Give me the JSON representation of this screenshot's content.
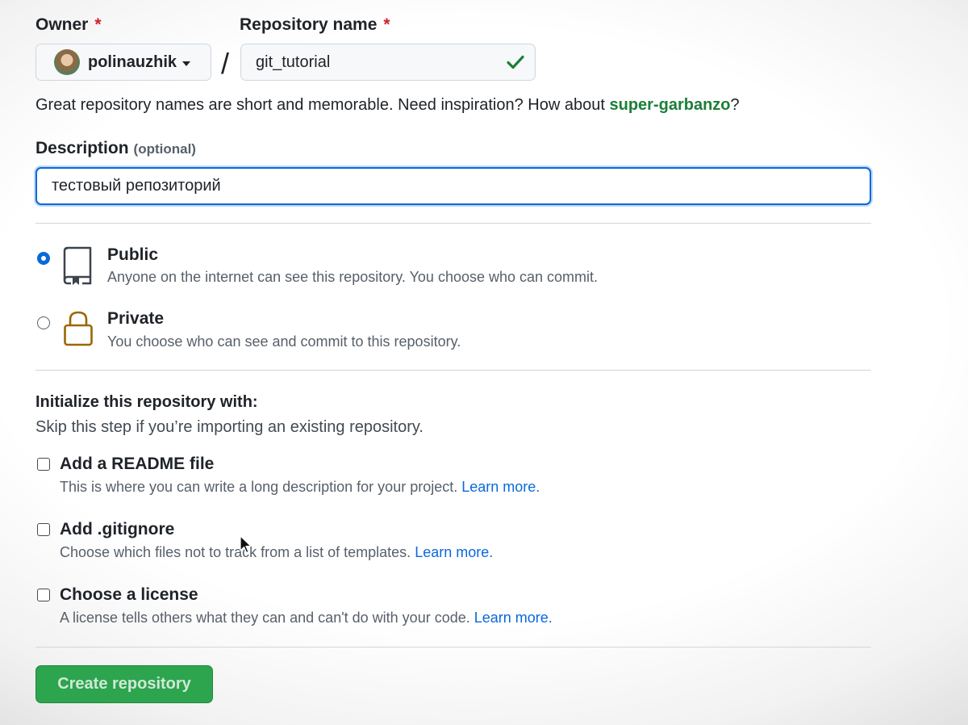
{
  "owner": {
    "label": "Owner",
    "required_mark": "*",
    "username": "polinauzhik"
  },
  "separator": "/",
  "repo": {
    "label": "Repository name",
    "required_mark": "*",
    "value": "git_tutorial"
  },
  "name_hint": {
    "prefix": "Great repository names are short and memorable. Need inspiration? How about ",
    "suggestion": "super-garbanzo",
    "suffix": "?"
  },
  "description": {
    "label": "Description",
    "optional": "(optional)",
    "value": "тестовый репозиторий"
  },
  "visibility": {
    "selected": "public",
    "public": {
      "title": "Public",
      "desc": "Anyone on the internet can see this repository. You choose who can commit."
    },
    "private": {
      "title": "Private",
      "desc": "You choose who can see and commit to this repository."
    }
  },
  "init": {
    "title": "Initialize this repository with:",
    "subtitle": "Skip this step if you’re importing an existing repository.",
    "options": [
      {
        "label": "Add a README file",
        "desc": "This is where you can write a long description for your project.",
        "link": "Learn more."
      },
      {
        "label": "Add .gitignore",
        "desc": "Choose which files not to track from a list of templates.",
        "link": "Learn more."
      },
      {
        "label": "Choose a license",
        "desc": "A license tells others what they can and can't do with your code.",
        "link": "Learn more."
      }
    ]
  },
  "create_button": "Create repository",
  "colors": {
    "accent": "#0969da",
    "success": "#2da44e",
    "required": "#cf222e",
    "private_icon": "#9a6700"
  },
  "icons": [
    "check-icon",
    "repo-icon",
    "lock-icon",
    "chevron-down-icon",
    "cursor-icon"
  ]
}
